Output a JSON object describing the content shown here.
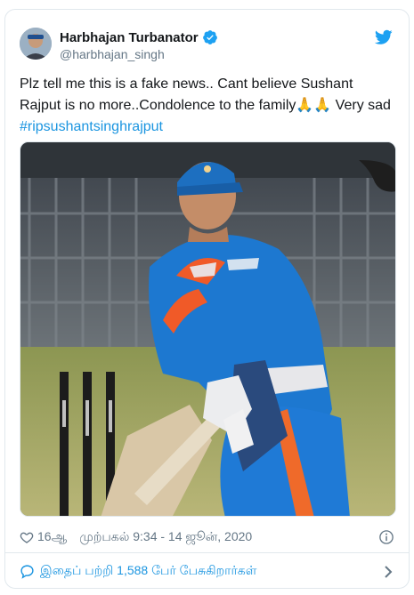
{
  "tweet": {
    "display_name": "Harbhajan Turbanator",
    "handle": "@harbhajan_singh",
    "text_main": "Plz tell me this is a fake news.. Cant believe Sushant Rajput is no more..Condolence to the family",
    "emoji": "🙏🙏",
    "text_after": " Very sad ",
    "hashtag": "#ripsushantsinghrajput",
    "likes": "16ஆ",
    "timestamp": "முற்பகல் 9:34 - 14 ஜூன், 2020",
    "conversation": "இதைப் பற்றி 1,588 பேர் பேசுகிறார்கள்"
  },
  "colors": {
    "link": "#1b95e0",
    "secondary_text": "#657786",
    "border": "#e1e8ed"
  },
  "icons": {
    "verified": "verified-badge-icon",
    "brand": "twitter-bird-icon",
    "like": "heart-icon",
    "info": "info-icon",
    "reply": "speech-bubble-icon",
    "chevron": "chevron-right-icon"
  }
}
